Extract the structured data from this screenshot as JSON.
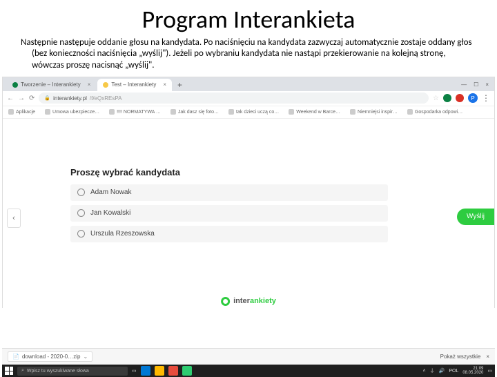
{
  "title": "Program Interankieta",
  "description": "Następnie następuje oddanie głosu na kandydata. Po naciśnięciu na kandydata zazwyczaj automatycznie zostaje oddany głos (bez konieczności naciśnięcia „wyślij\"). Jeżeli po wybraniu kandydata nie nastąpi przekierowanie na kolejną stronę, wówczas proszę nacisnąć „wyślij\".",
  "browser": {
    "tabs": [
      {
        "label": "Tworzenie – Interankiety"
      },
      {
        "label": "Test – Interankiety"
      }
    ],
    "address_prefix": "interankiety.pl",
    "address_path": "/f/eQxREsPA",
    "avatar_initial": "P",
    "bookmarks": [
      "Aplikacje",
      "Umowa ubezpiecze…",
      "!!!! NORMATYWA …",
      "Jak dasz się foto…",
      "tak dzieci uczą co…",
      "Weekend w Barce…",
      "Niemniejsi inspir…",
      "Gospodarka odpowi…"
    ]
  },
  "form": {
    "heading": "Proszę wybrać kandydata",
    "options": [
      "Adam Nowak",
      "Jan Kowalski",
      "Urszula Rzeszowska"
    ],
    "submit": "Wyślij",
    "prev": "‹"
  },
  "brand": {
    "name": "inter",
    "name2": "ankiety"
  },
  "downloads": {
    "file": "download - 2020-0…zip",
    "show_all": "Pokaż wszystkie"
  },
  "taskbar": {
    "search_placeholder": "Wpisz tu wyszukiwane słowa",
    "lang": "POL",
    "time": "21:09",
    "date": "08.05.2020"
  }
}
